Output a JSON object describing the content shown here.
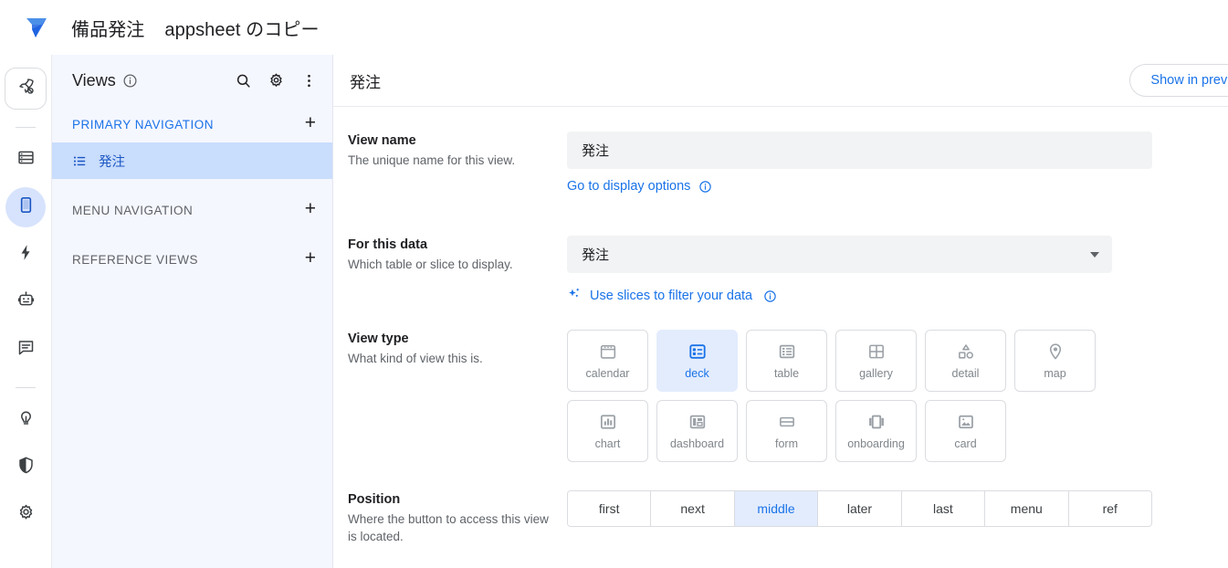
{
  "topbar": {
    "logo_icon": "appsheet-logo",
    "app_title": "備品発注",
    "app_subtitle": "appsheet のコピー"
  },
  "rail": {
    "items": [
      {
        "icon": "rocket-icon",
        "name": "rail-item-launch",
        "state": "boxed"
      },
      {
        "icon": "database-icon",
        "name": "rail-item-data",
        "state": "normal"
      },
      {
        "icon": "device-phone-icon",
        "name": "rail-item-app",
        "state": "active"
      },
      {
        "icon": "bolt-icon",
        "name": "rail-item-automation",
        "state": "normal"
      },
      {
        "icon": "robot-icon",
        "name": "rail-item-intelligence",
        "state": "normal"
      },
      {
        "icon": "chat-icon",
        "name": "rail-item-chat",
        "state": "normal"
      },
      {
        "icon": "lightbulb-icon",
        "name": "rail-item-ideas",
        "state": "normal"
      },
      {
        "icon": "shield-icon",
        "name": "rail-item-security",
        "state": "normal"
      },
      {
        "icon": "gear-icon",
        "name": "rail-item-settings",
        "state": "normal"
      }
    ]
  },
  "views_panel": {
    "title": "Views",
    "info_icon": "info-icon",
    "search_icon": "search-icon",
    "gear_icon": "gear-icon",
    "overflow_icon": "more-vertical-icon",
    "sections": [
      {
        "label": "PRIMARY NAVIGATION",
        "add_label": "+"
      },
      {
        "label": "MENU NAVIGATION",
        "add_label": "+"
      },
      {
        "label": "REFERENCE VIEWS",
        "add_label": "+"
      }
    ],
    "primary_items": [
      {
        "label": "発注",
        "icon": "list-icon",
        "selected": true
      }
    ]
  },
  "main": {
    "view_heading": "発注",
    "show_in_preview_label": "Show in preview",
    "fields": {
      "view_name": {
        "label": "View name",
        "desc": "The unique name for this view.",
        "value": "発注",
        "link": "Go to display options",
        "link_info_icon": "info-icon"
      },
      "for_this_data": {
        "label": "For this data",
        "desc": "Which table or slice to display.",
        "value": "発注",
        "slices_link": "Use slices to filter your data",
        "slices_icon": "sparkle-icon",
        "link_info_icon": "info-icon"
      },
      "view_type": {
        "label": "View type",
        "desc": "What kind of view this is.",
        "selected": "deck",
        "options": [
          {
            "label": "calendar",
            "icon": "calendar-icon"
          },
          {
            "label": "deck",
            "icon": "deck-icon"
          },
          {
            "label": "table",
            "icon": "table-icon"
          },
          {
            "label": "gallery",
            "icon": "gallery-icon"
          },
          {
            "label": "detail",
            "icon": "detail-icon"
          },
          {
            "label": "map",
            "icon": "map-pin-icon"
          },
          {
            "label": "chart",
            "icon": "chart-icon"
          },
          {
            "label": "dashboard",
            "icon": "dashboard-icon"
          },
          {
            "label": "form",
            "icon": "form-icon"
          },
          {
            "label": "onboarding",
            "icon": "onboarding-icon"
          },
          {
            "label": "card",
            "icon": "card-icon"
          }
        ]
      },
      "position": {
        "label": "Position",
        "desc": "Where the button to access this view is located.",
        "selected": "middle",
        "options": [
          "first",
          "next",
          "middle",
          "later",
          "last",
          "menu",
          "ref"
        ]
      }
    }
  },
  "colors": {
    "accent_blue": "#1a73e8",
    "selected_tile_bg": "#e3ecfd",
    "selected_view_bg": "#c9ddfc",
    "panel_bg": "#f5f7ff",
    "field_bg": "#f1f3f4"
  }
}
